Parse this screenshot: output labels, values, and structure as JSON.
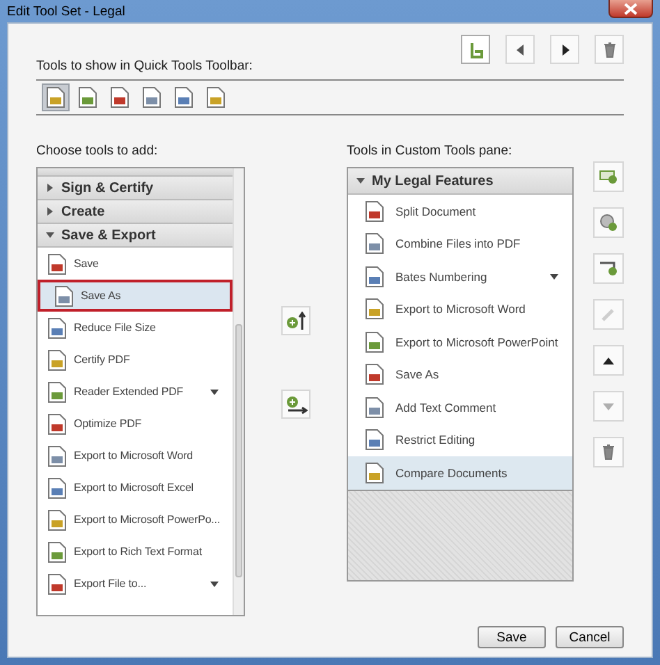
{
  "window": {
    "title": "Edit Tool Set - Legal"
  },
  "toolbar_label": "Tools to show in Quick Tools Toolbar:",
  "top_buttons": [
    {
      "kind": "format",
      "disabled": false
    },
    {
      "kind": "left",
      "disabled": false
    },
    {
      "kind": "right",
      "disabled": false
    },
    {
      "kind": "delete",
      "disabled": false
    }
  ],
  "quick_tools": [
    {
      "selected": true
    },
    {
      "selected": false
    },
    {
      "selected": false
    },
    {
      "selected": false
    },
    {
      "selected": false
    },
    {
      "selected": false
    }
  ],
  "left_panel": {
    "label": "Choose tools to add:",
    "items": [
      {
        "kind": "header",
        "label": "Sign & Certify",
        "expanded": false
      },
      {
        "kind": "header",
        "label": "Create",
        "expanded": false
      },
      {
        "kind": "header",
        "label": "Save & Export",
        "expanded": true
      },
      {
        "kind": "tool",
        "label": "Save",
        "selected": false,
        "has_menu": false
      },
      {
        "kind": "tool",
        "label": "Save As",
        "selected": true,
        "has_menu": false
      },
      {
        "kind": "tool",
        "label": "Reduce File Size",
        "selected": false,
        "has_menu": false
      },
      {
        "kind": "tool",
        "label": "Certify PDF",
        "selected": false,
        "has_menu": false
      },
      {
        "kind": "tool",
        "label": "Reader Extended PDF",
        "selected": false,
        "has_menu": true
      },
      {
        "kind": "tool",
        "label": "Optimize PDF",
        "selected": false,
        "has_menu": false
      },
      {
        "kind": "tool",
        "label": "Export to Microsoft Word",
        "selected": false,
        "has_menu": false
      },
      {
        "kind": "tool",
        "label": "Export to Microsoft Excel",
        "selected": false,
        "has_menu": false
      },
      {
        "kind": "tool",
        "label": "Export to Microsoft PowerPo...",
        "selected": false,
        "has_menu": false
      },
      {
        "kind": "tool",
        "label": "Export to Rich Text Format",
        "selected": false,
        "has_menu": false
      },
      {
        "kind": "tool",
        "label": "Export File to...",
        "selected": false,
        "has_menu": true
      }
    ]
  },
  "middle_buttons": [
    {
      "kind": "add-panel"
    },
    {
      "kind": "add-tool"
    }
  ],
  "right_panel": {
    "label": "Tools in Custom Tools pane:",
    "items": [
      {
        "kind": "header",
        "label": "My Legal Features",
        "expanded": true
      },
      {
        "kind": "tool",
        "label": "Split Document",
        "selected": false,
        "has_menu": false
      },
      {
        "kind": "tool",
        "label": "Combine Files into PDF",
        "selected": false,
        "has_menu": false
      },
      {
        "kind": "tool",
        "label": "Bates Numbering",
        "selected": false,
        "has_menu": true
      },
      {
        "kind": "tool",
        "label": "Export to Microsoft Word",
        "selected": false,
        "has_menu": false
      },
      {
        "kind": "tool",
        "label": "Export to Microsoft PowerPoint",
        "selected": false,
        "has_menu": false
      },
      {
        "kind": "tool",
        "label": "Save As",
        "selected": false,
        "has_menu": false
      },
      {
        "kind": "tool",
        "label": "Add Text Comment",
        "selected": false,
        "has_menu": false
      },
      {
        "kind": "tool",
        "label": "Restrict Editing",
        "selected": false,
        "has_menu": false
      },
      {
        "kind": "tool",
        "label": "Compare Documents",
        "selected": true,
        "has_menu": false
      }
    ]
  },
  "side_buttons": [
    {
      "kind": "new-panel",
      "disabled": false
    },
    {
      "kind": "settings",
      "disabled": false
    },
    {
      "kind": "divider",
      "disabled": false
    },
    {
      "kind": "rename",
      "disabled": true
    },
    {
      "kind": "up",
      "disabled": false
    },
    {
      "kind": "down",
      "disabled": true
    },
    {
      "kind": "delete",
      "disabled": false
    }
  ],
  "buttons": [
    "Save",
    "Cancel"
  ]
}
